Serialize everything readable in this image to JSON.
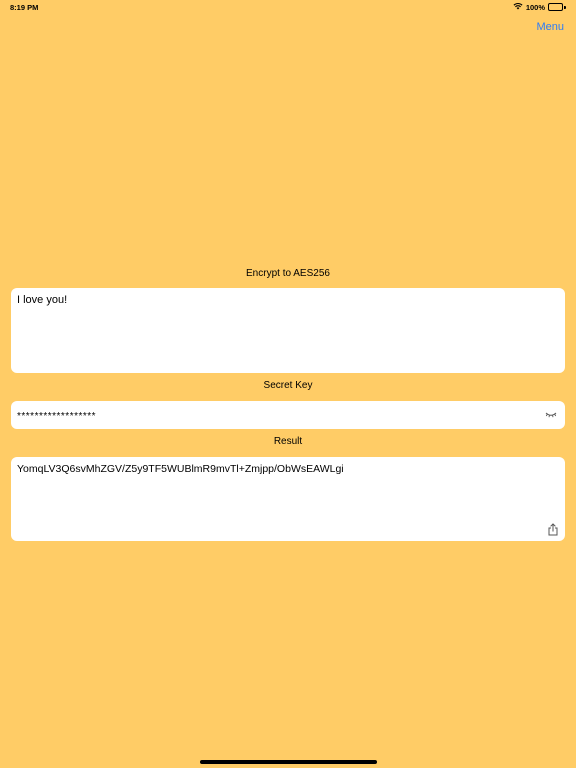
{
  "status_bar": {
    "time": "8:19 PM",
    "battery_percent": "100%",
    "wifi_icon": "wifi-icon",
    "battery_icon": "battery-full-icon",
    "battery_level": 1.0
  },
  "nav": {
    "menu_label": "Menu",
    "accent_color": "#2E7CF6"
  },
  "encrypt": {
    "title": "Encrypt to AES256",
    "input_value": "I love you!"
  },
  "secret_key": {
    "label": "Secret Key",
    "masked_value": "******************",
    "toggle_icon": "eye-closed-icon"
  },
  "result": {
    "label": "Result",
    "value": "YomqLV3Q6svMhZGV/Z5y9TF5WUBlmR9mvTl+Zmjpp/ObWsEAWLgi",
    "share_icon": "share-icon"
  },
  "colors": {
    "background": "#FFCC66",
    "field_background": "#FFFFFF"
  }
}
